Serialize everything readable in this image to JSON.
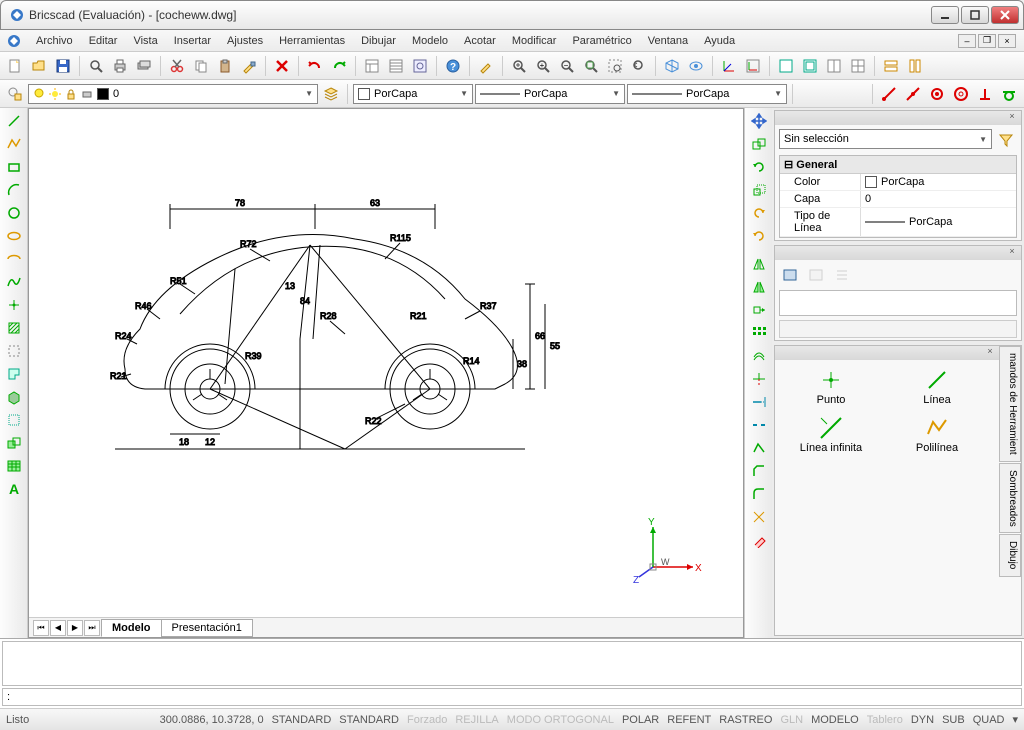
{
  "window": {
    "title": "Bricscad (Evaluación) - [cocheww.dwg]"
  },
  "menu": [
    "Archivo",
    "Editar",
    "Vista",
    "Insertar",
    "Ajustes",
    "Herramientas",
    "Dibujar",
    "Modelo",
    "Acotar",
    "Modificar",
    "Paramétrico",
    "Ventana",
    "Ayuda"
  ],
  "layer_props": {
    "layer_name": "0",
    "color_label": "PorCapa",
    "linetype_label": "PorCapa",
    "lineweight_label": "PorCapa"
  },
  "tabs": {
    "active": "Modelo",
    "other": "Presentación1"
  },
  "properties": {
    "selection": "Sin selección",
    "group": "General",
    "rows": [
      {
        "key": "Color",
        "val": "PorCapa",
        "swatch": "#ffffff"
      },
      {
        "key": "Capa",
        "val": "0"
      },
      {
        "key": "Tipo de Línea",
        "val": "PorCapa",
        "line": true
      }
    ]
  },
  "palette": {
    "items": [
      "Punto",
      "Línea",
      "Línea infinita",
      "Polilínea"
    ],
    "side_tabs": [
      "mandos de Herramient",
      "Sombreados",
      "Dibujo"
    ]
  },
  "command_prompt": ":",
  "status": {
    "ready": "Listo",
    "coords": "300.0886, 10.3728, 0",
    "std1": "STANDARD",
    "std2": "STANDARD",
    "toggles": [
      "Forzado",
      "REJILLA",
      "MODO ORTOGONAL",
      "POLAR",
      "REFENT",
      "RASTREO",
      "GLN",
      "MODELO",
      "Tablero",
      "DYN",
      "SUB",
      "QUAD"
    ],
    "dim_toggles": [
      "Forzado",
      "REJILLA",
      "MODO ORTOGONAL",
      "GLN",
      "Tablero"
    ]
  },
  "ucs_labels": {
    "x": "X",
    "y": "Y",
    "z": "Z",
    "w": "W"
  },
  "dimensions": {
    "top": [
      "78",
      "63"
    ],
    "radii": [
      "R72",
      "R115",
      "R51",
      "R46",
      "R24",
      "R21",
      "R39",
      "R28",
      "R37",
      "R22",
      "R14",
      "R21"
    ],
    "linear": [
      "13",
      "84",
      "66",
      "63",
      "55",
      "38"
    ],
    "bottom": [
      "18",
      "12"
    ]
  }
}
